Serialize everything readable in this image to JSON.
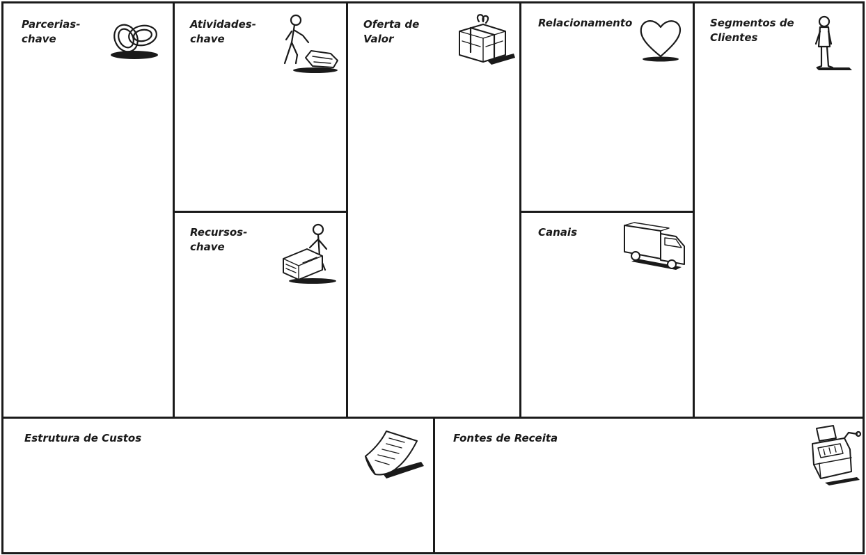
{
  "canvas": {
    "key_partners": {
      "title": "Parcerias-\nchave",
      "icon": "linked-rings-icon"
    },
    "key_activities": {
      "title": "Atividades-\nchave",
      "icon": "worker-icon"
    },
    "key_resources": {
      "title": "Recursos-\nchave",
      "icon": "machine-icon"
    },
    "value_proposition": {
      "title": "Oferta de\nValor",
      "icon": "gift-icon"
    },
    "customer_relationships": {
      "title": "Relacionamento",
      "icon": "heart-icon"
    },
    "channels": {
      "title": "Canais",
      "icon": "truck-icon"
    },
    "customer_segments": {
      "title": "Segmentos de\nClientes",
      "icon": "person-icon"
    },
    "cost_structure": {
      "title": "Estrutura de Custos",
      "icon": "invoice-icon"
    },
    "revenue_streams": {
      "title": "Fontes de Receita",
      "icon": "cash-register-icon"
    }
  }
}
